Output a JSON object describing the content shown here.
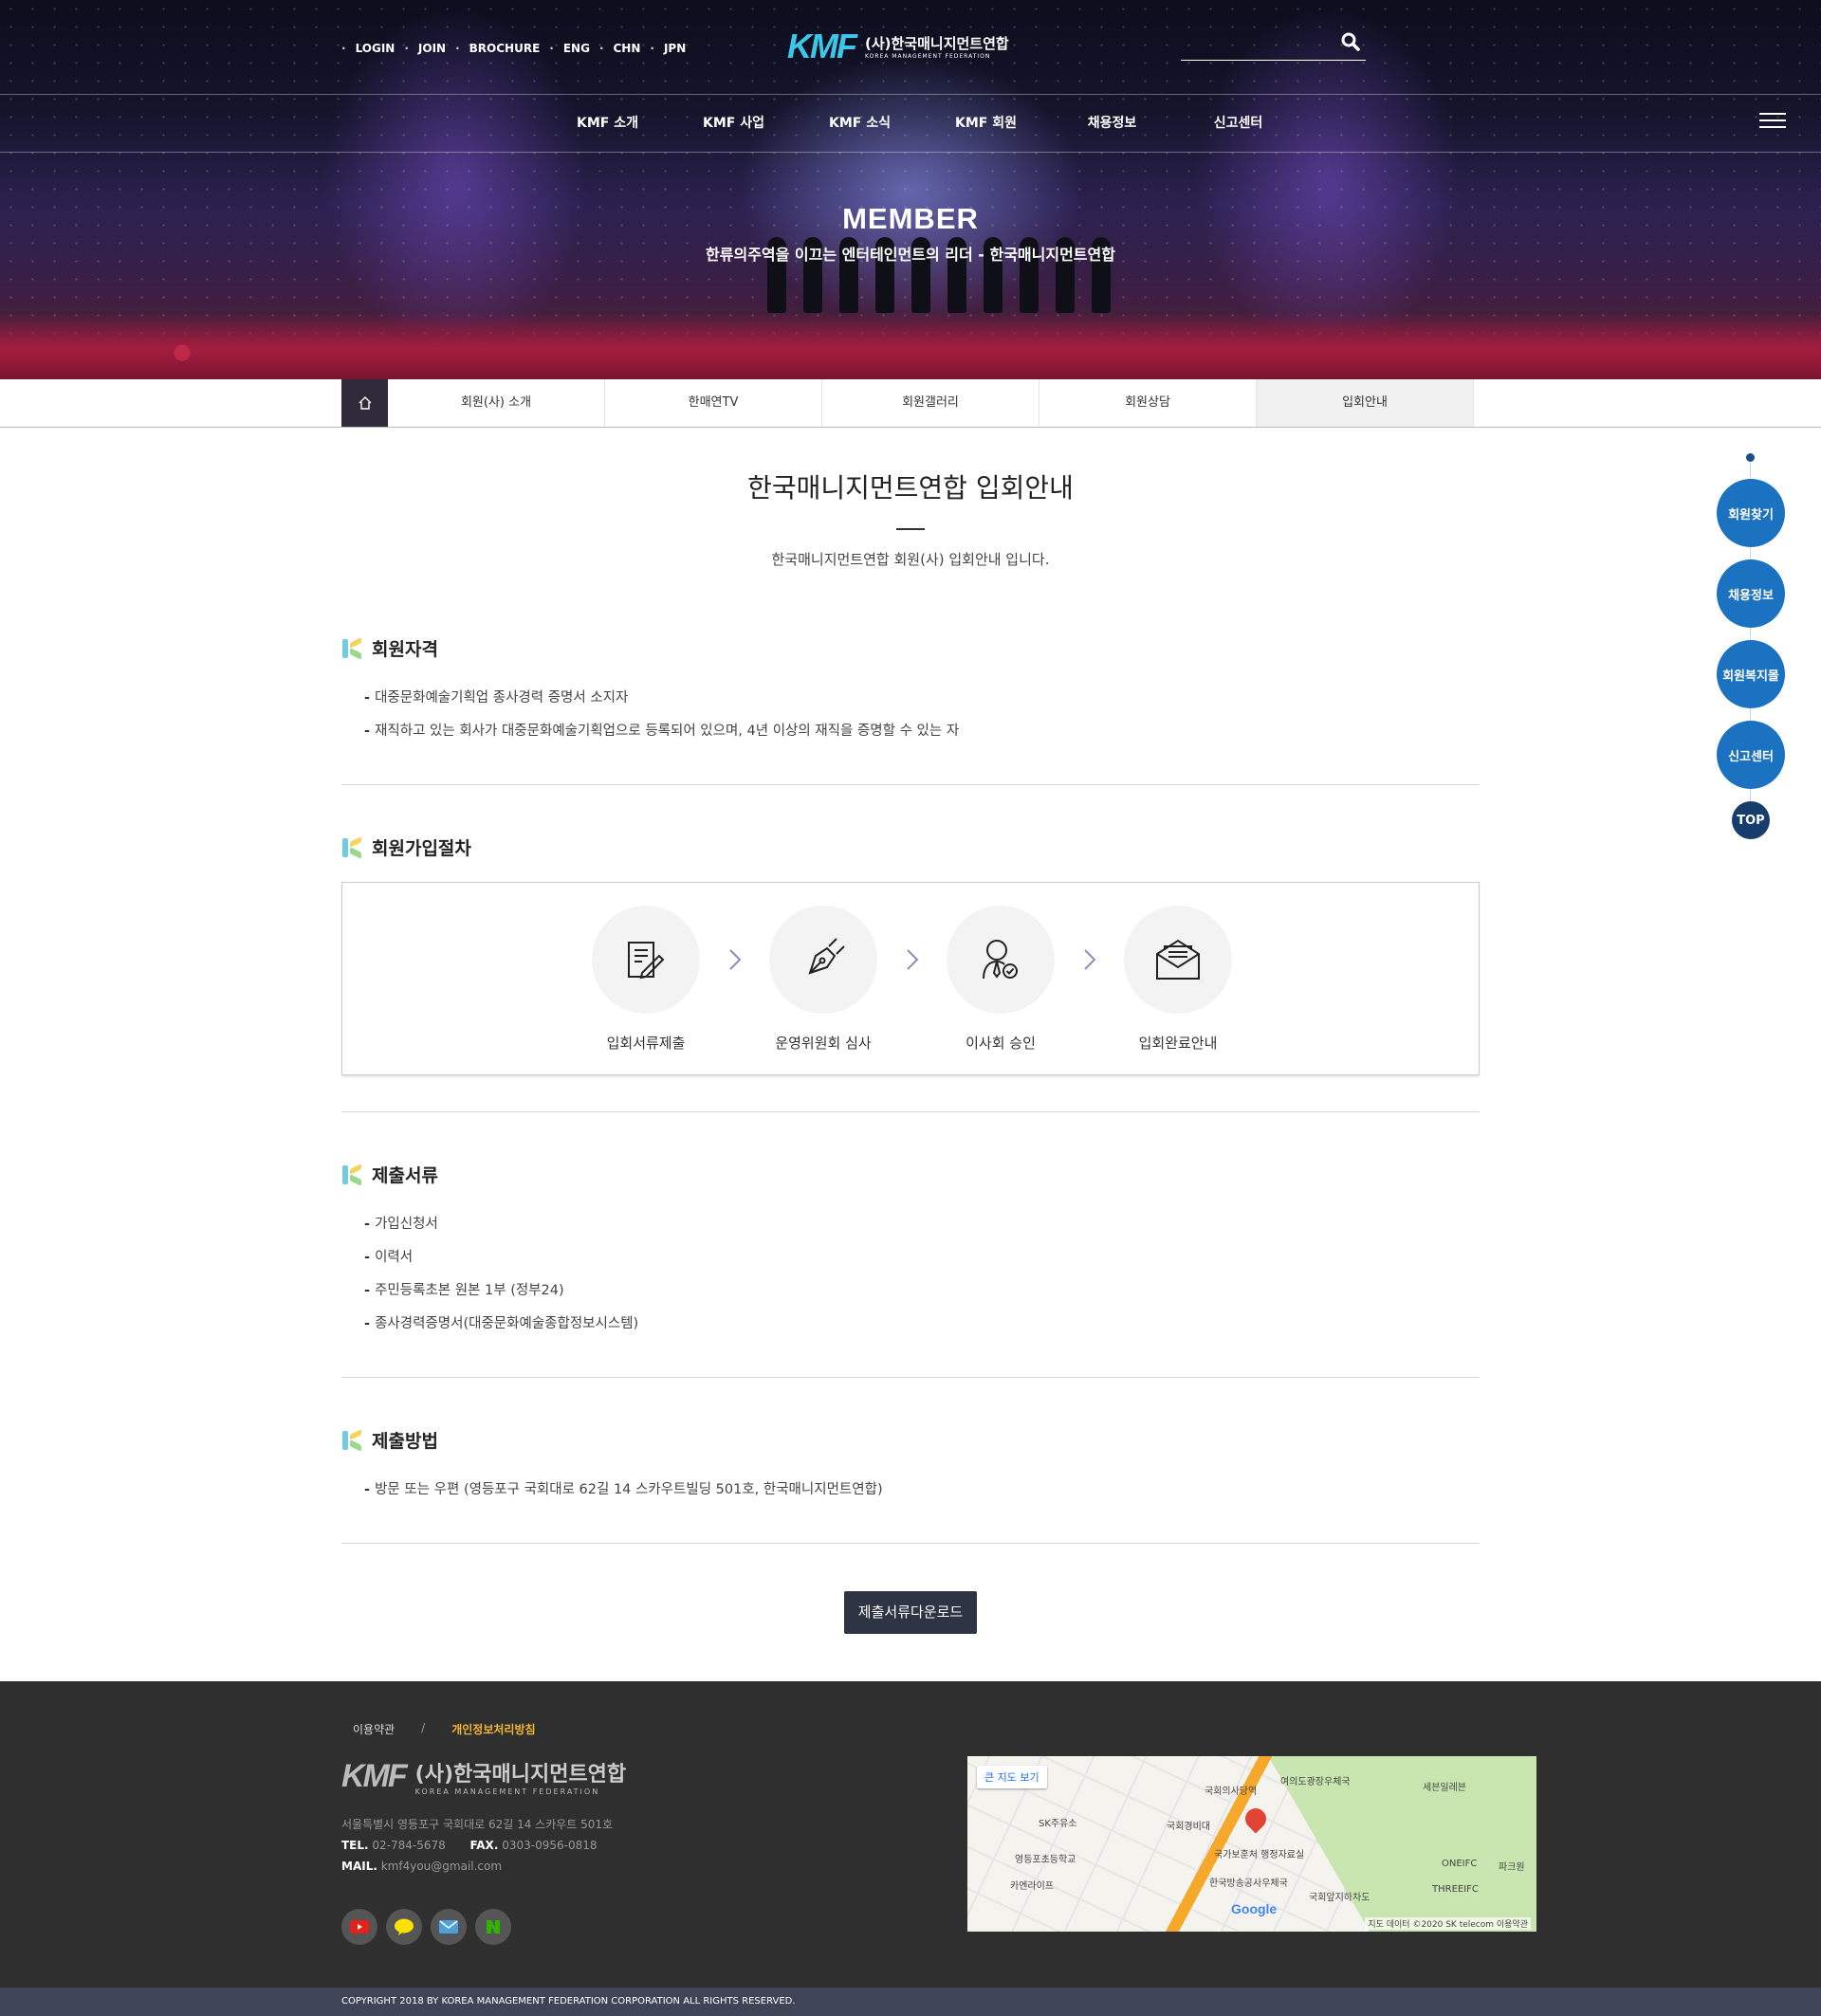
{
  "header": {
    "util_links": [
      "LOGIN",
      "JOIN",
      "BROCHURE",
      "ENG",
      "CHN",
      "JPN"
    ],
    "logo_mark": "KMF",
    "logo_ko": "(사)한국매니지먼트연합",
    "logo_en": "KOREA MANAGEMENT FEDERATION",
    "search_placeholder": "",
    "gnb": [
      "KMF 소개",
      "KMF 사업",
      "KMF 소식",
      "KMF 회원",
      "채용정보",
      "신고센터"
    ]
  },
  "hero": {
    "title": "MEMBER",
    "subtitle": "한류의주역을 이끄는 엔터테인먼트의 리더 - 한국매니지먼트연합"
  },
  "lnb": {
    "tabs": [
      "회원(사) 소개",
      "한매연TV",
      "회원갤러리",
      "회원상담",
      "입회안내"
    ],
    "active_index": 4
  },
  "page": {
    "title": "한국매니지먼트연합 입회안내",
    "desc": "한국매니지먼트연합 회원(사) 입회안내 입니다."
  },
  "sections": {
    "qualification": {
      "title": "회원자격",
      "items": [
        "대중문화예술기획업 종사경력 증명서 소지자",
        "재직하고 있는 회사가 대중문화예술기획업으로 등록되어 있으며, 4년 이상의 재직을 증명할 수 있는 자"
      ]
    },
    "procedure": {
      "title": "회원가입절차",
      "steps": [
        "입회서류제출",
        "운영위원회 심사",
        "이사회 승인",
        "입회완료안내"
      ]
    },
    "documents": {
      "title": "제출서류",
      "items": [
        "가입신청서",
        "이력서",
        "주민등록초본 원본 1부 (정부24)",
        "종사경력증명서(대중문화예술종합정보시스템)"
      ]
    },
    "method": {
      "title": "제출방법",
      "items": [
        "방문 또는 우편 (영등포구 국회대로 62길 14 스카우트빌딩 501호, 한국매니지먼트연합)"
      ]
    }
  },
  "download_label": "제출서류다운로드",
  "quick": {
    "items": [
      "회원찾기",
      "채용정보",
      "회원복지몰",
      "신고센터"
    ],
    "top": "TOP"
  },
  "footer": {
    "link_terms": "이용약관",
    "link_sep": "/",
    "link_privacy": "개인정보처리방침",
    "logo_mark": "KMF",
    "logo_ko": "(사)한국매니지먼트연합",
    "logo_en": "KOREA MANAGEMENT FEDERATION",
    "address": "서울특별시 영등포구 국회대로 62길 14 스카우트 501호",
    "tel_label": "TEL.",
    "tel": "02-784-5678",
    "fax_label": "FAX.",
    "fax": "0303-0956-0818",
    "mail_label": "MAIL.",
    "mail": "kmf4you@gmail.com",
    "sns": [
      "youtube-icon",
      "kakaotalk-icon",
      "mail-icon",
      "naver-icon"
    ],
    "map": {
      "big_map": "큰 지도 보기",
      "google": "Google",
      "attribution": "지도 데이터 ©2020 SK telecom   이용약관",
      "labels": [
        "국회의사당역",
        "여의도광장우체국",
        "국가보훈처 행정자료실",
        "한국방송공사우체국",
        "영등포초등학교",
        "SK주유소",
        "카엔라이프",
        "국회경비대",
        "ONEIFC",
        "THREEIFC",
        "파크원",
        "국회앞지하차도",
        "세븐일레븐"
      ]
    },
    "copyright": "COPYRIGHT 2018 BY KOREA MANAGEMENT FEDERATION CORPORATION ALL RIGHTS RESERVED."
  }
}
